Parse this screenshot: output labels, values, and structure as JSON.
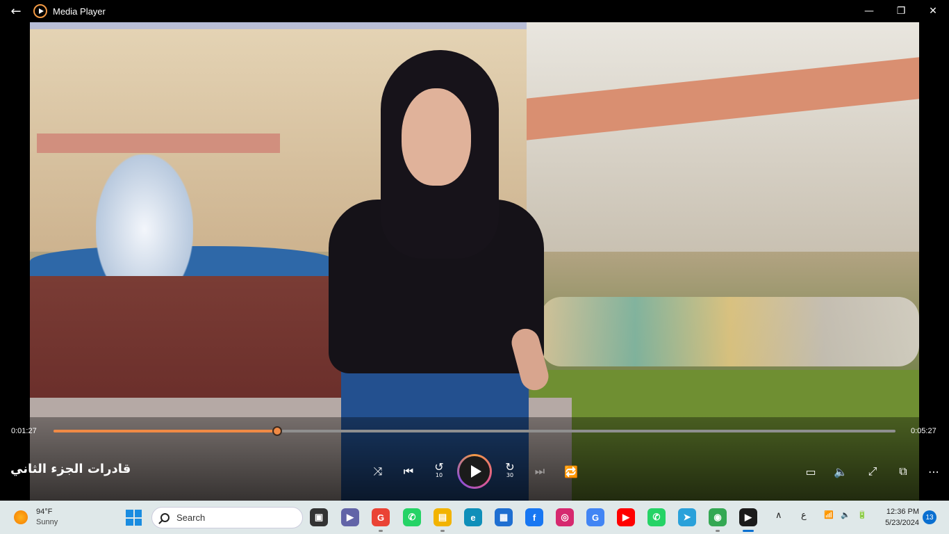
{
  "window": {
    "title": "Media Player",
    "back_glyph": "←",
    "minimize_glyph": "—",
    "maximize_glyph": "❐",
    "close_glyph": "✕"
  },
  "player": {
    "current_time": "0:01:27",
    "duration": "0:05:27",
    "progress_fraction": 0.266,
    "media_title": "قادرات الجزء الثاني",
    "accent_color": "#f08a45",
    "controls": {
      "shuffle": "⤨",
      "previous": "⏮",
      "rewind": "↺",
      "rewind_label": "10",
      "forward": "↻",
      "forward_label": "30",
      "next": "⏭",
      "repeat": "🔁",
      "subtitles": "▭",
      "volume": "🔈",
      "fullscreen": "⤢",
      "miniplayer": "⧉",
      "more": "⋯"
    }
  },
  "taskbar": {
    "weather": {
      "temp": "94°F",
      "condition": "Sunny"
    },
    "search_placeholder": "Search",
    "apps": [
      {
        "name": "task-view",
        "glyph": "▣",
        "color": "#333333"
      },
      {
        "name": "teams",
        "glyph": "▶",
        "color": "#6264a7"
      },
      {
        "name": "google",
        "glyph": "G",
        "color": "#ea4335"
      },
      {
        "name": "whatsapp",
        "glyph": "✆",
        "color": "#25d366"
      },
      {
        "name": "file-explorer",
        "glyph": "▤",
        "color": "#f2b300"
      },
      {
        "name": "edge",
        "glyph": "e",
        "color": "#0f8fb9"
      },
      {
        "name": "store",
        "glyph": "▦",
        "color": "#1f6fd1"
      },
      {
        "name": "facebook",
        "glyph": "f",
        "color": "#1877f2"
      },
      {
        "name": "instagram",
        "glyph": "◎",
        "color": "#d6296f"
      },
      {
        "name": "google-2",
        "glyph": "G",
        "color": "#4285f4"
      },
      {
        "name": "youtube",
        "glyph": "▶",
        "color": "#ff0000"
      },
      {
        "name": "whatsapp-2",
        "glyph": "✆",
        "color": "#25d366"
      },
      {
        "name": "telegram",
        "glyph": "➤",
        "color": "#2aa1da"
      },
      {
        "name": "chrome",
        "glyph": "◉",
        "color": "#34a853"
      },
      {
        "name": "media-player",
        "glyph": "▶",
        "color": "#1b1b1b"
      }
    ],
    "tray": {
      "chevron": "∧",
      "language": "ع",
      "wifi": "📶",
      "speaker": "🔈",
      "battery": "🔋"
    },
    "time": "12:36 PM",
    "date": "5/23/2024",
    "notification_count": "13"
  }
}
